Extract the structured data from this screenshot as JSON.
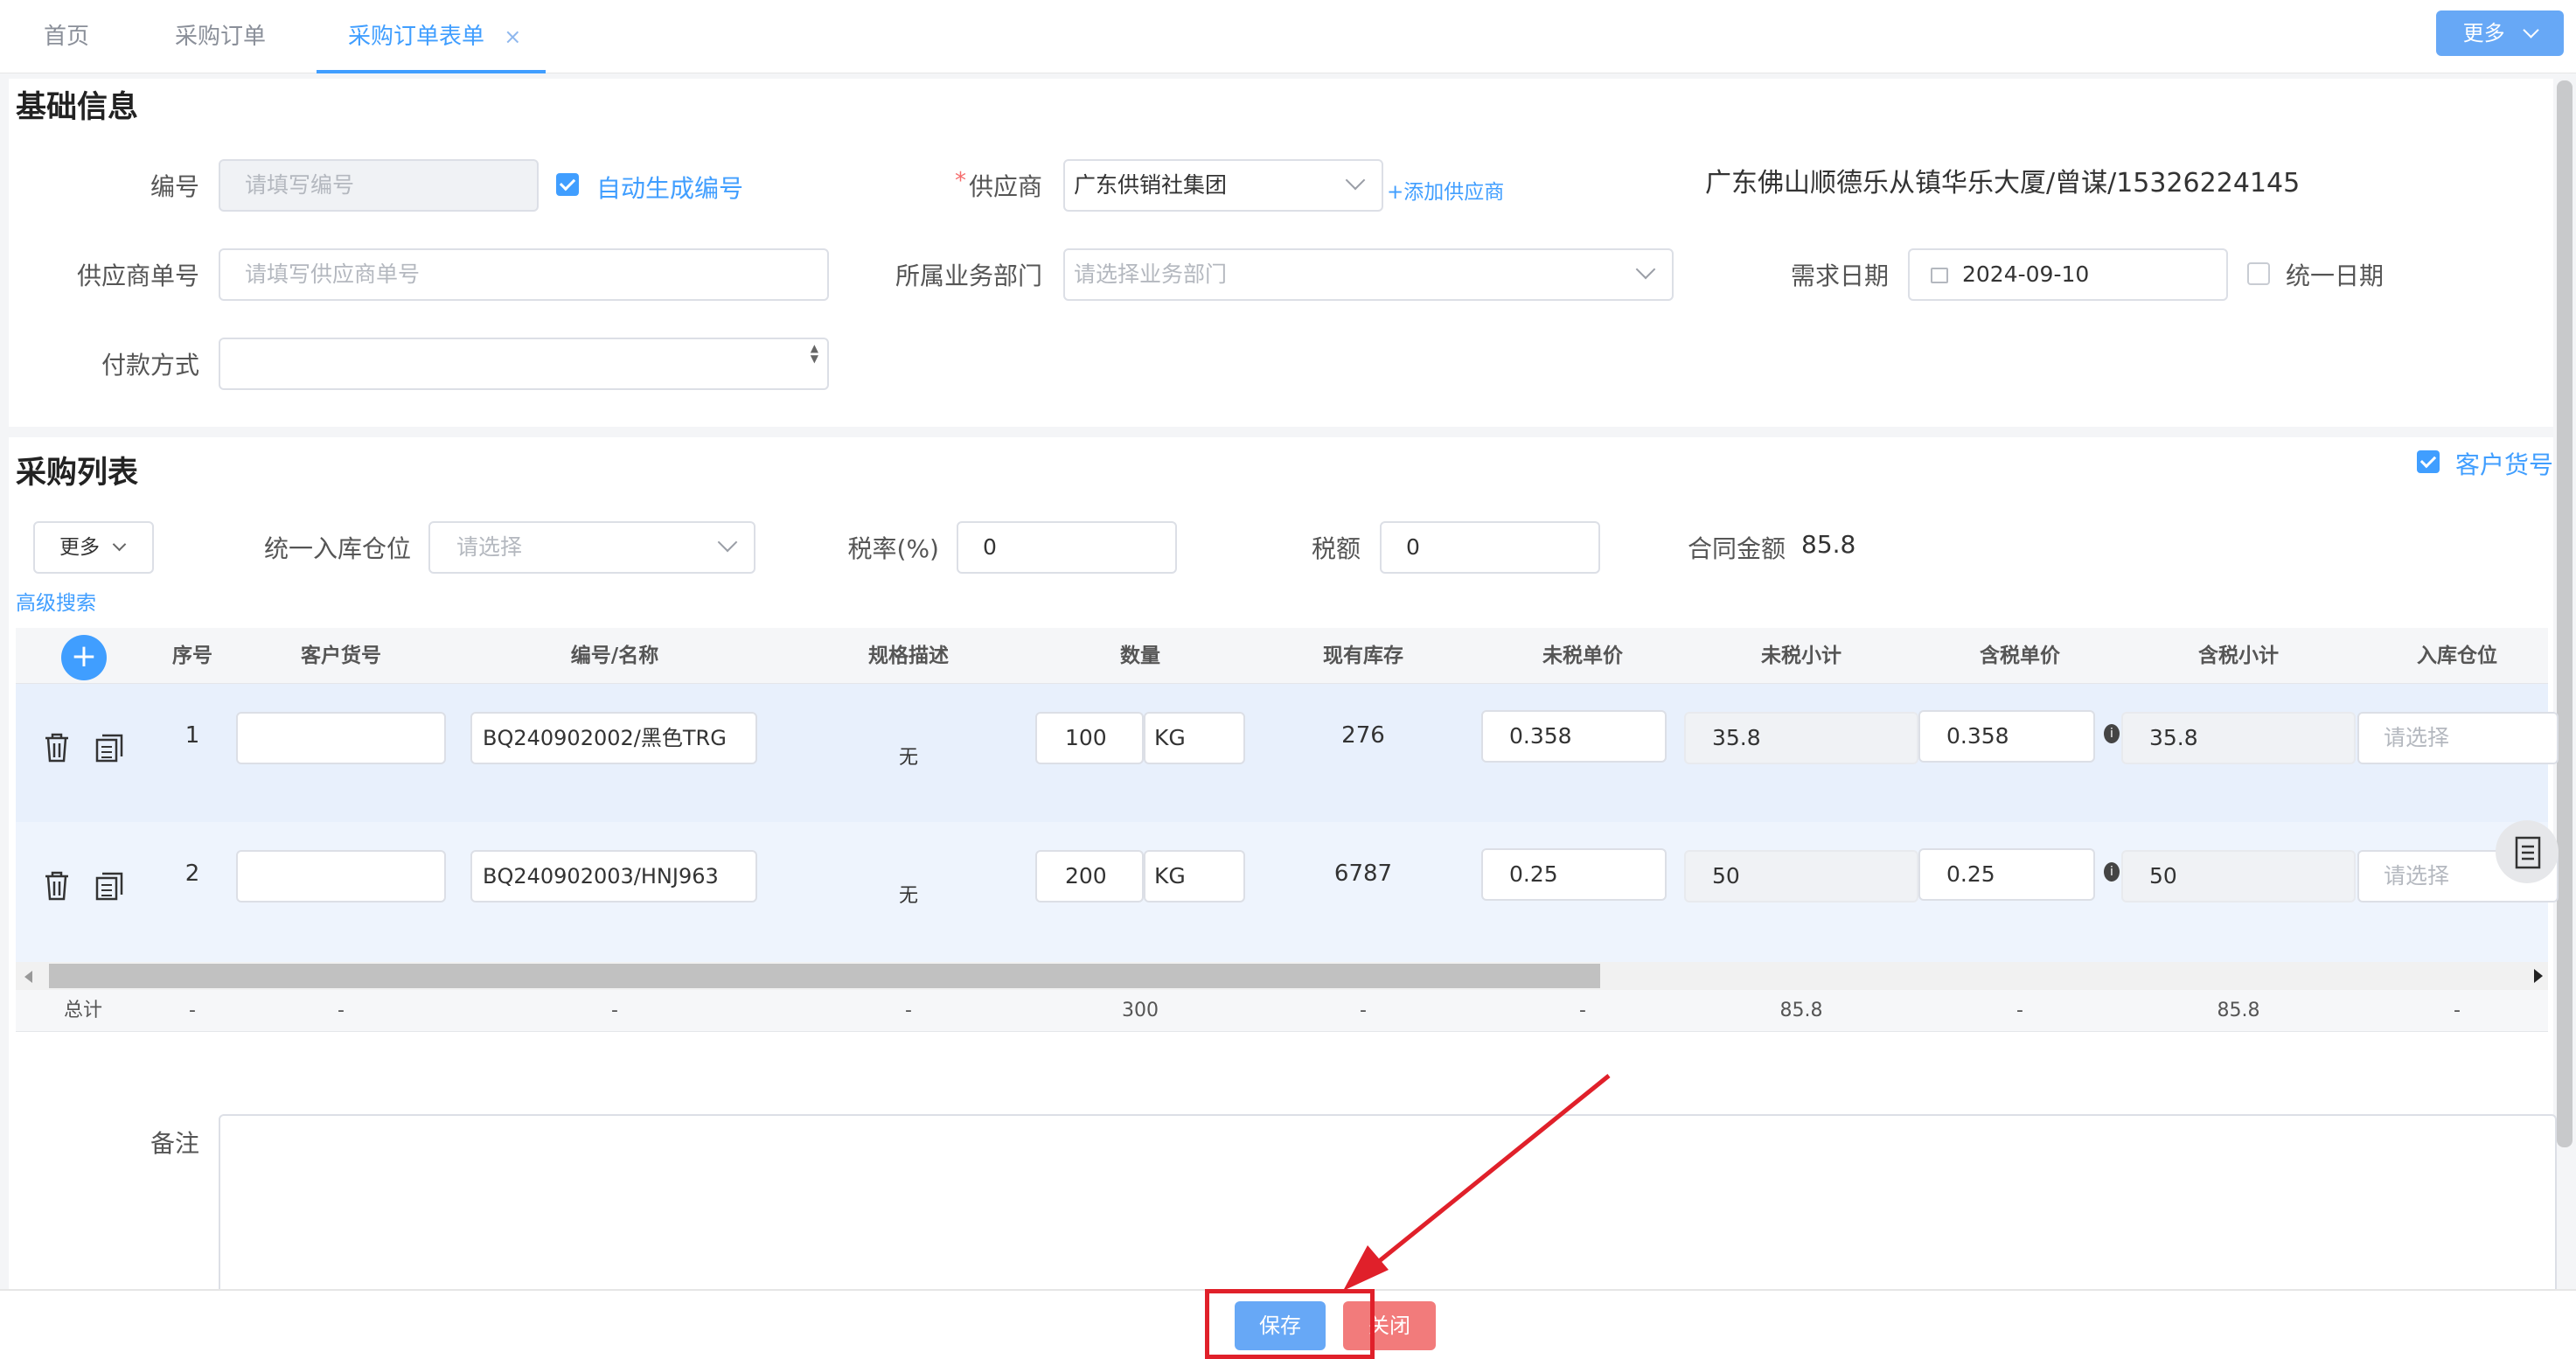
{
  "tabs": [
    {
      "label": "首页",
      "active": false
    },
    {
      "label": "采购订单",
      "active": false
    },
    {
      "label": "采购订单表单",
      "active": true
    }
  ],
  "tab_close": "×",
  "top_right_more": "更多",
  "basic": {
    "title": "基础信息",
    "code_label": "编号",
    "code_placeholder": "请填写编号",
    "auto_code_label": "自动生成编号",
    "supplier_label": "供应商",
    "supplier_required": "*",
    "supplier_value": "广东供销社集团",
    "add_supplier": "+添加供应商",
    "supplier_info": "广东佛山顺德乐从镇华乐大厦/曾谋/15326224145",
    "supplier_no_label": "供应商单号",
    "supplier_no_placeholder": "请填写供应商单号",
    "dept_label": "所属业务部门",
    "dept_placeholder": "请选择业务部门",
    "date_label": "需求日期",
    "date_value": "2024-09-10",
    "unify_date_label": "统一日期",
    "pay_label": "付款方式"
  },
  "list": {
    "title": "采购列表",
    "customer_no_toggle": "客户货号",
    "more_btn": "更多",
    "warehouse_label": "统一入库仓位",
    "warehouse_placeholder": "请选择",
    "tax_rate_label": "税率(%)",
    "tax_rate_value": "0",
    "tax_amount_label": "税额",
    "tax_amount_value": "0",
    "contract_label": "合同金额",
    "contract_value": "85.8",
    "advanced_search": "高级搜索"
  },
  "table": {
    "add_symbol": "+",
    "columns": [
      "序号",
      "客户货号",
      "编号/名称",
      "规格描述",
      "数量",
      "现有库存",
      "未税单价",
      "未税小计",
      "含税单价",
      "含税小计",
      "入库仓位"
    ],
    "rows": [
      {
        "idx": "1",
        "customer_no": "",
        "code": "BQ240902002/黑色TRG",
        "spec": "无",
        "qty": "100",
        "unit": "KG",
        "stock": "276",
        "price_ex": "0.358",
        "subtotal_ex": "35.8",
        "price_in": "0.358",
        "subtotal_in": "35.8",
        "warehouse_placeholder": "请选择"
      },
      {
        "idx": "2",
        "customer_no": "",
        "code": "BQ240902003/HNJ963",
        "spec": "无",
        "qty": "200",
        "unit": "KG",
        "stock": "6787",
        "price_ex": "0.25",
        "subtotal_ex": "50",
        "price_in": "0.25",
        "subtotal_in": "50",
        "warehouse_placeholder": "请选择"
      }
    ],
    "summary": [
      "总计",
      "-",
      "-",
      "-",
      "-",
      "300",
      "-",
      "-",
      "85.8",
      "-",
      "85.8",
      "-"
    ]
  },
  "remark_label": "备注",
  "footer": {
    "save": "保存",
    "close": "关闭"
  },
  "colors": {
    "primary": "#409eff",
    "danger": "#f56c6c",
    "annotation": "#e0202a",
    "row_bg": "#e8f0fc"
  }
}
